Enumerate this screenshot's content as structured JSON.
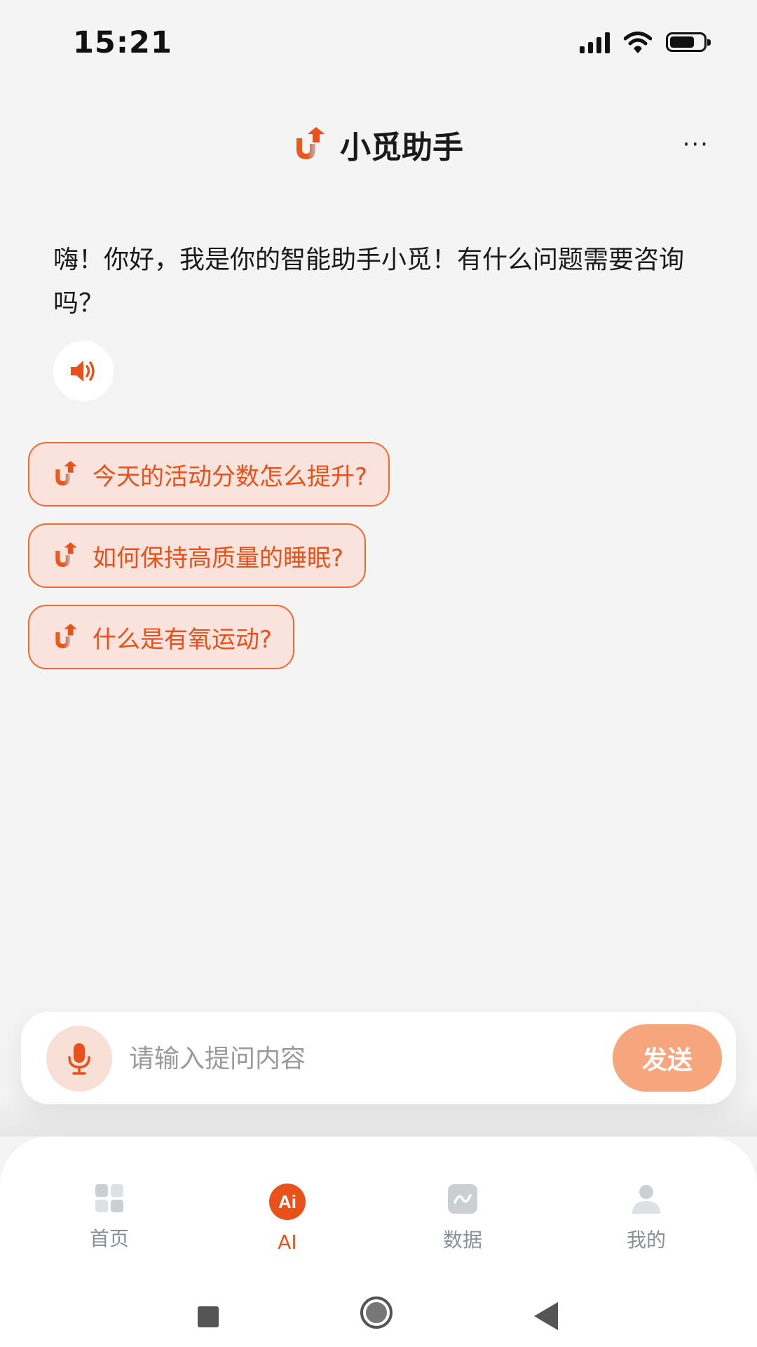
{
  "status_bar": {
    "time": "15:21",
    "icons": [
      "signal-icon",
      "wifi-icon",
      "battery-icon"
    ]
  },
  "header": {
    "logo_icon": "app-logo-icon",
    "title": "小觅助手",
    "more_label": "···"
  },
  "chat": {
    "greeting": "嗨！你好，我是你的智能助手小觅！有什么问题需要咨询吗？",
    "speaker_icon": "speaker-icon"
  },
  "suggestions": [
    {
      "label": "今天的活动分数怎么提升?",
      "icon": "app-logo-icon"
    },
    {
      "label": "如何保持高质量的睡眠?",
      "icon": "app-logo-icon"
    },
    {
      "label": "什么是有氧运动?",
      "icon": "app-logo-icon"
    }
  ],
  "input_bar": {
    "mic_icon": "microphone-icon",
    "placeholder": "请输入提问内容",
    "send_label": "发送"
  },
  "tabs": [
    {
      "label": "首页",
      "icon": "grid-icon",
      "active": false
    },
    {
      "label": "AI",
      "icon": "ai-icon",
      "active": true
    },
    {
      "label": "数据",
      "icon": "chart-icon",
      "active": false
    },
    {
      "label": "我的",
      "icon": "user-icon",
      "active": false
    }
  ],
  "colors": {
    "accent": "#e8521a",
    "suggestion_bg": "#f9e3dc",
    "send_button": "#f6a57c",
    "inactive_tab": "#8a8f94",
    "background": "#f4f4f4"
  }
}
